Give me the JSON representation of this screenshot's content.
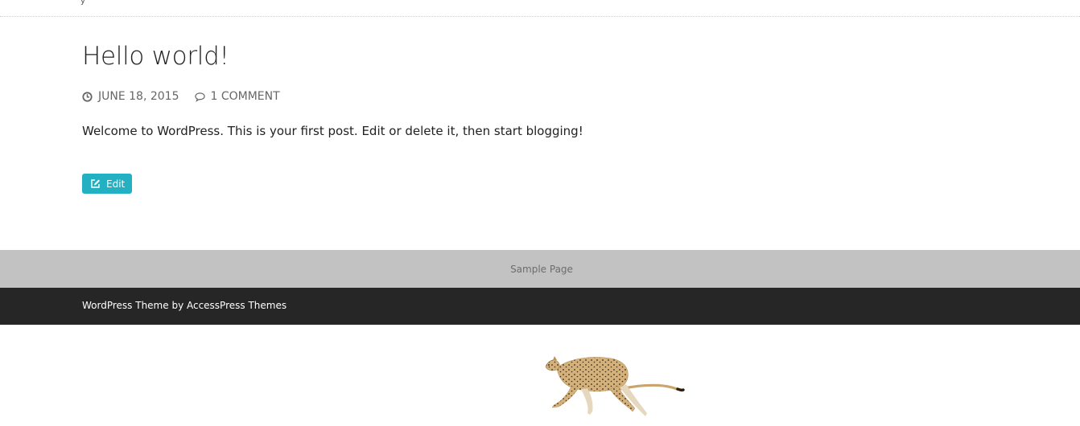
{
  "header": {
    "stray_mark": "y"
  },
  "post": {
    "title": "Hello world!",
    "date": "JUNE 18, 2015",
    "comments": "1 COMMENT",
    "body": "Welcome to WordPress. This is your first post. Edit or delete it, then start blogging!",
    "edit_label": "Edit"
  },
  "menu": {
    "items": [
      "Sample Page"
    ]
  },
  "footer": {
    "credit": "WordPress Theme by AccessPress Themes"
  },
  "colors": {
    "accent": "#22b0c2",
    "menu_bg": "#c2c2c2",
    "footer_bg": "#262626"
  },
  "icons": {
    "date": "clock-icon",
    "comments": "comment-icon",
    "edit": "edit-icon",
    "animation": "cheetah-image"
  }
}
